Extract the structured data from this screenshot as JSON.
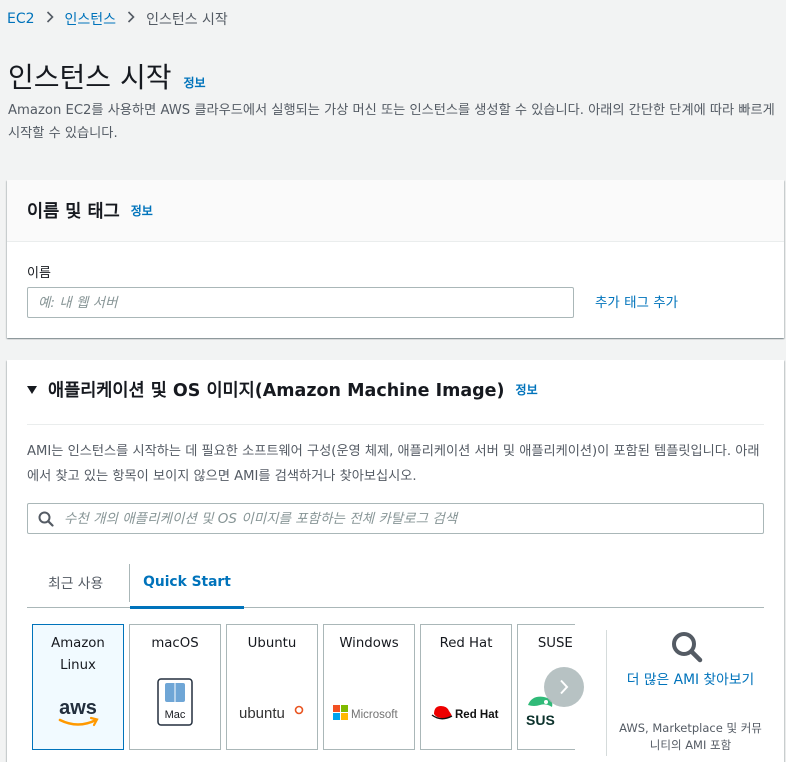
{
  "breadcrumb": {
    "root": "EC2",
    "level1": "인스턴스",
    "current": "인스턴스 시작"
  },
  "page": {
    "title": "인스턴스 시작",
    "info": "정보",
    "description": "Amazon EC2를 사용하면 AWS 클라우드에서 실행되는 가상 머신 또는 인스턴스를 생성할 수 있습니다. 아래의 간단한 단계에 따라 빠르게 시작할 수 있습니다."
  },
  "name_tags": {
    "title": "이름 및 태그",
    "info": "정보",
    "name_label": "이름",
    "name_placeholder": "예: 내 웹 서버",
    "add_tags": "추가 태그 추가"
  },
  "ami": {
    "title": "애플리케이션 및 OS 이미지(Amazon Machine Image)",
    "info": "정보",
    "description": "AMI는 인스턴스를 시작하는 데 필요한 소프트웨어 구성(운영 체제, 애플리케이션 서버 및 애플리케이션)이 포함된 템플릿입니다. 아래에서 찾고 있는 항목이 보이지 않으면 AMI를 검색하거나 찾아보십시오.",
    "search_placeholder": "수천 개의 애플리케이션 및 OS 이미지를 포함하는 전체 카탈로그 검색",
    "tabs": [
      "최근 사용",
      "Quick Start"
    ],
    "active_tab": "Quick Start",
    "os_cards": [
      {
        "label": "Amazon Linux",
        "logo": "aws",
        "selected": true
      },
      {
        "label": "macOS",
        "logo": "Mac",
        "selected": false
      },
      {
        "label": "Ubuntu",
        "logo": "ubuntu",
        "selected": false
      },
      {
        "label": "Windows",
        "logo": "Microsoft",
        "selected": false
      },
      {
        "label": "Red Hat",
        "logo": "Red Hat",
        "selected": false
      },
      {
        "label": "SUSE Li",
        "logo": "SUS",
        "selected": false
      }
    ],
    "more_ami": "더 많은 AMI 찾아보기",
    "more_ami_sub": "AWS, Marketplace 및 커뮤니티의 AMI 포함"
  },
  "colors": {
    "link": "#0073bb",
    "selected_bg": "#f1faff",
    "aws_orange": "#ff9900",
    "ubuntu_orange": "#e95420",
    "redhat_red": "#ee0000"
  }
}
